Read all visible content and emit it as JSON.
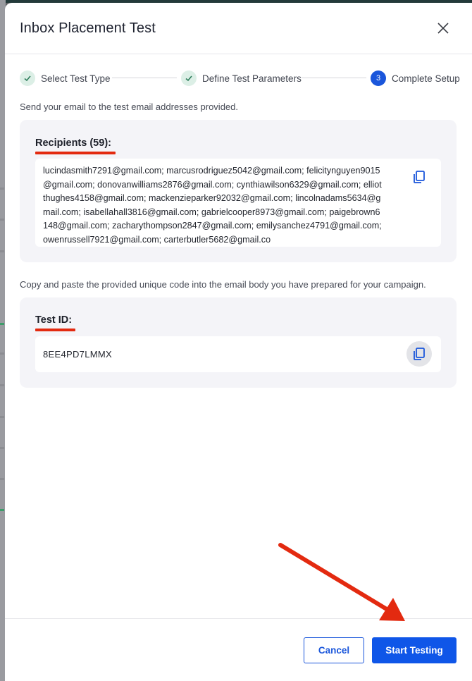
{
  "modal": {
    "title": "Inbox Placement Test"
  },
  "stepper": {
    "steps": [
      {
        "label": "Select Test Type",
        "state": "done"
      },
      {
        "label": "Define Test Parameters",
        "state": "done"
      },
      {
        "label": "Complete Setup",
        "state": "active",
        "number": "3"
      }
    ]
  },
  "recipients_section": {
    "instruction": "Send your email to the test email addresses provided.",
    "heading": "Recipients (59):",
    "addresses": "lucindasmith7291@gmail.com; marcusrodriguez5042@gmail.com; felicitynguyen9015@gmail.com; donovanwilliams2876@gmail.com; cynthiawilson6329@gmail.com; elliotthughes4158@gmail.com; mackenzieparker92032@gmail.com; lincolnadams5634@gmail.com; isabellahall3816@gmail.com; gabrielcooper8973@gmail.com; paigebrown6148@gmail.com; zacharythompson2847@gmail.com; emilysanchez4791@gmail.com; owenrussell7921@gmail.com; carterbutler5682@gmail.co"
  },
  "test_id_section": {
    "instruction": "Copy and paste the provided unique code into the email body you have prepared for your campaign.",
    "heading": "Test ID:",
    "code": "8EE4PD7LMMX"
  },
  "footer": {
    "cancel_label": "Cancel",
    "start_label": "Start Testing"
  },
  "colors": {
    "primary": "#0f56e8",
    "annotation_red": "#e32a10",
    "step_done_bg": "#dcefe6",
    "check_green": "#2e7d5b"
  }
}
